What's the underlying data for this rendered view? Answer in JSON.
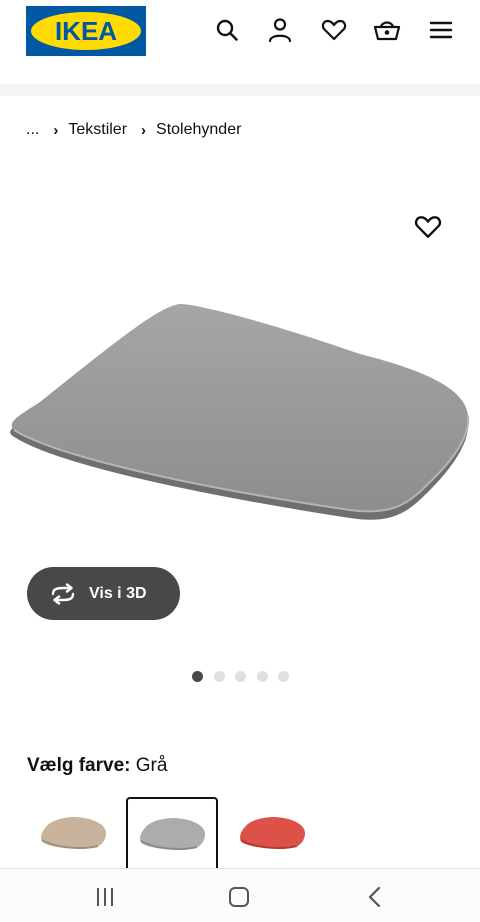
{
  "header": {
    "logo_text": "IKEA",
    "icons": [
      "search-icon",
      "user-icon",
      "heart-icon",
      "basket-icon",
      "menu-icon"
    ],
    "brand_blue": "#0058a3",
    "brand_yellow": "#ffdb00"
  },
  "breadcrumb": {
    "items": [
      "...",
      "Tekstiler",
      "Stolehynder"
    ]
  },
  "product": {
    "favorite_icon": "heart-icon",
    "image_icon": "seat-cushion",
    "view3d_label": "Vis i 3D",
    "gallery": {
      "count": 5,
      "active": 1
    }
  },
  "color_picker": {
    "label": "Vælg farve:",
    "selected_value": "Grå",
    "swatches": [
      {
        "name": "beige",
        "color": "#c9b8a3"
      },
      {
        "name": "grå",
        "color": "#a9a9a9",
        "selected": true
      },
      {
        "name": "rød",
        "color": "#d9534a"
      }
    ]
  },
  "navbar": {
    "buttons": [
      "recent-apps-icon",
      "home-icon",
      "back-icon"
    ]
  }
}
